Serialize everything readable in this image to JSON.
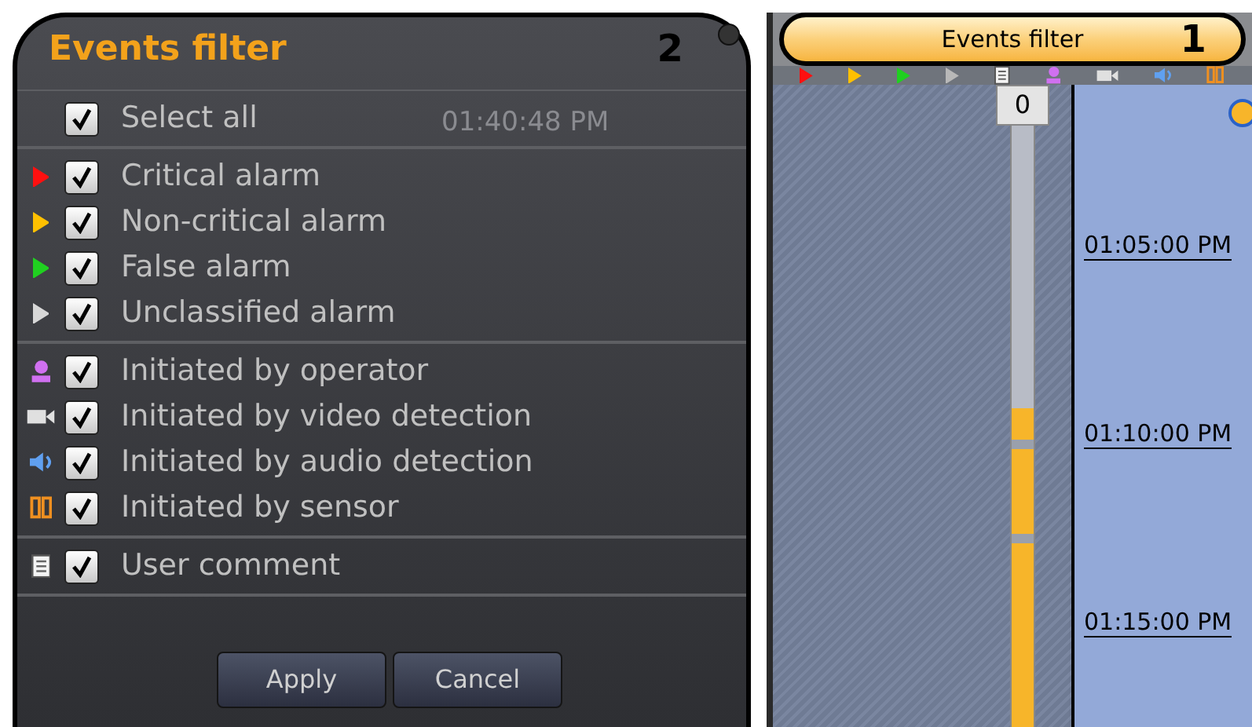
{
  "dialog": {
    "title": "Events filter",
    "background_time": "01:40:48 PM",
    "groups": [
      [
        {
          "label": "Select all",
          "checked": true,
          "kind": "none"
        }
      ],
      [
        {
          "label": "Critical alarm",
          "checked": true,
          "kind": "triangle",
          "color": "#ff1010"
        },
        {
          "label": "Non-critical alarm",
          "checked": true,
          "kind": "triangle",
          "color": "#ffc000"
        },
        {
          "label": "False alarm",
          "checked": true,
          "kind": "triangle",
          "color": "#20d020"
        },
        {
          "label": "Unclassified alarm",
          "checked": true,
          "kind": "triangle",
          "color": "#d8d8d8"
        }
      ],
      [
        {
          "label": "Initiated by operator",
          "checked": true,
          "kind": "user"
        },
        {
          "label": "Initiated by video detection",
          "checked": true,
          "kind": "camera"
        },
        {
          "label": "Initiated by audio detection",
          "checked": true,
          "kind": "speaker"
        },
        {
          "label": "Initiated by sensor",
          "checked": true,
          "kind": "sensor"
        }
      ],
      [
        {
          "label": "User comment",
          "checked": true,
          "kind": "comment"
        }
      ]
    ],
    "buttons": [
      "Apply",
      "Cancel"
    ]
  },
  "callouts": [
    {
      "label": "2"
    },
    {
      "label": "1"
    }
  ],
  "panel": {
    "filter_button": "Events filter",
    "toolbar": [
      {
        "kind": "triangle",
        "color": "#ff1010"
      },
      {
        "kind": "triangle",
        "color": "#ffc000"
      },
      {
        "kind": "triangle",
        "color": "#20d020"
      },
      {
        "kind": "triangle",
        "color": "#b8b8b8"
      },
      {
        "kind": "comment"
      },
      {
        "kind": "user"
      },
      {
        "kind": "camera"
      },
      {
        "kind": "speaker"
      },
      {
        "kind": "sensor"
      }
    ],
    "counter": "0",
    "times": [
      "01:05:00 PM",
      "01:10:00 PM",
      "01:15:00 PM"
    ]
  }
}
